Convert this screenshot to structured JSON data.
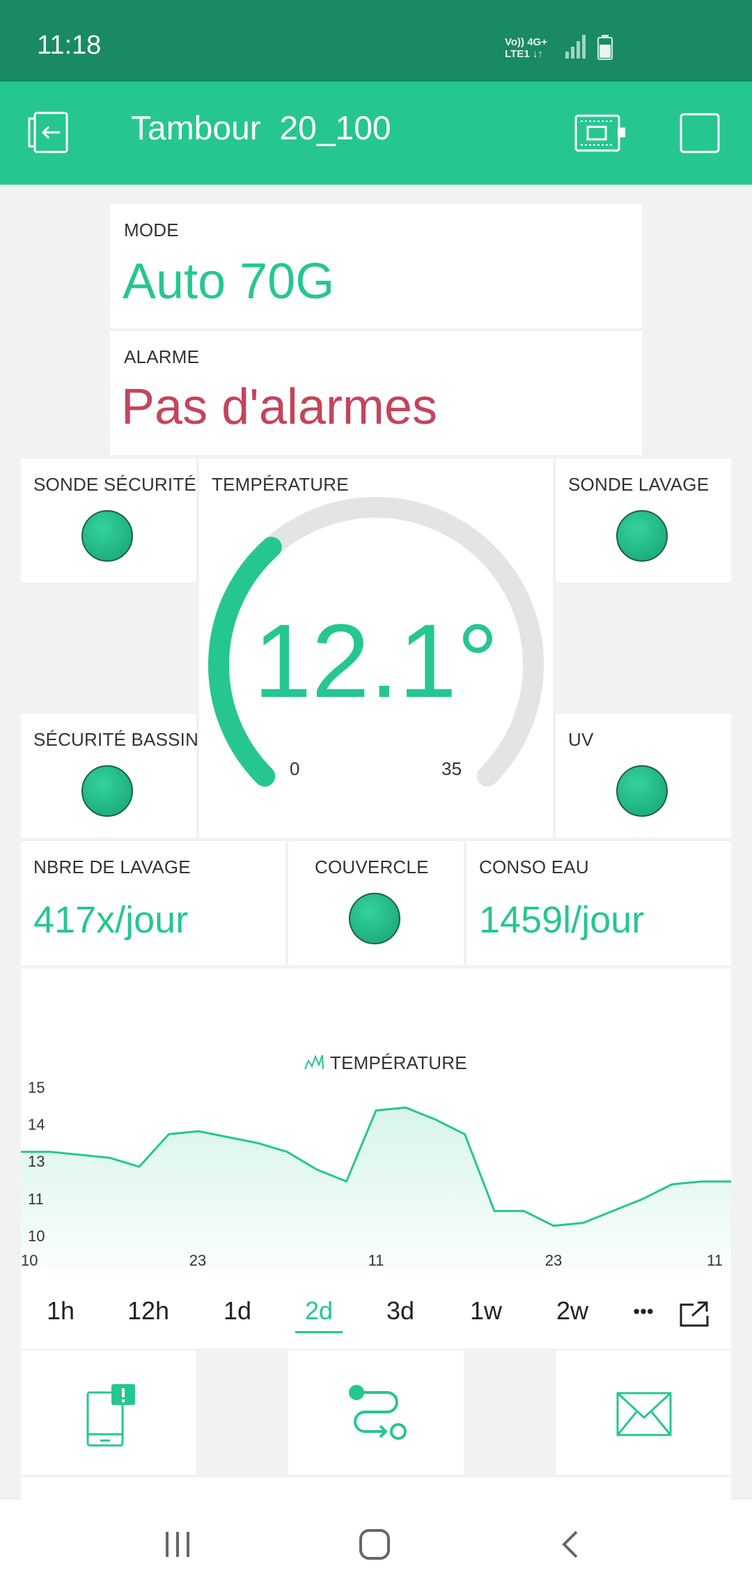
{
  "status_bar": {
    "time": "11:18",
    "network_line1": "Vo)) 4G+",
    "network_line2": "LTE1 ↓↑"
  },
  "header": {
    "title": "Tambour  20_100"
  },
  "widgets": {
    "mode": {
      "label": "MODE",
      "value": "Auto 70G"
    },
    "alarme": {
      "label": "ALARME",
      "value": "Pas d'alarmes"
    },
    "sonde_securite": {
      "label": "SONDE SÉCURITÉ"
    },
    "temperature_gauge": {
      "label": "TEMPÉRATURE",
      "value": "12.1°",
      "min_label": "0",
      "max_label": "35",
      "level": 12.1,
      "min": 0,
      "max": 35
    },
    "sonde_lavage": {
      "label": "SONDE LAVAGE"
    },
    "securite_bassin": {
      "label": "SÉCURITÉ BASSIN"
    },
    "uv": {
      "label": "UV"
    },
    "nbre_lavage": {
      "label": "NBRE DE LAVAGE",
      "value": "417x/jour"
    },
    "couvercle": {
      "label": "COUVERCLE"
    },
    "conso_eau": {
      "label": "CONSO EAU",
      "value": "1459l/jour"
    }
  },
  "chart_data": {
    "type": "area",
    "legend": "TEMPÉRATURE",
    "y_tick_labels": [
      "15",
      "14",
      "13",
      "11",
      "10"
    ],
    "x_tick_labels": [
      "10",
      "23",
      "11",
      "23",
      "11"
    ],
    "series": [
      {
        "values": [
          13.0,
          13.0,
          12.9,
          12.8,
          12.5,
          13.6,
          13.7,
          13.5,
          13.3,
          13.0,
          12.4,
          12.0,
          14.4,
          14.5,
          14.1,
          13.6,
          11.0,
          11.0,
          10.5,
          10.6,
          11.0,
          11.4,
          11.9,
          12.0,
          12.0
        ]
      }
    ],
    "ylim": [
      10,
      15
    ]
  },
  "tabs": [
    "1h",
    "12h",
    "1d",
    "2d",
    "3d",
    "1w",
    "2w",
    "•••"
  ],
  "active_tab": "2d",
  "colors": {
    "accent": "#26c690",
    "status_bar": "#1a8a62",
    "alarm_text": "#c3455b"
  },
  "icons": {
    "back": "exit-icon",
    "device": "device-board-icon",
    "square": "square-icon",
    "notification": "phone-notification-icon",
    "route": "route-icon",
    "mail": "mail-icon",
    "export": "export-icon"
  }
}
